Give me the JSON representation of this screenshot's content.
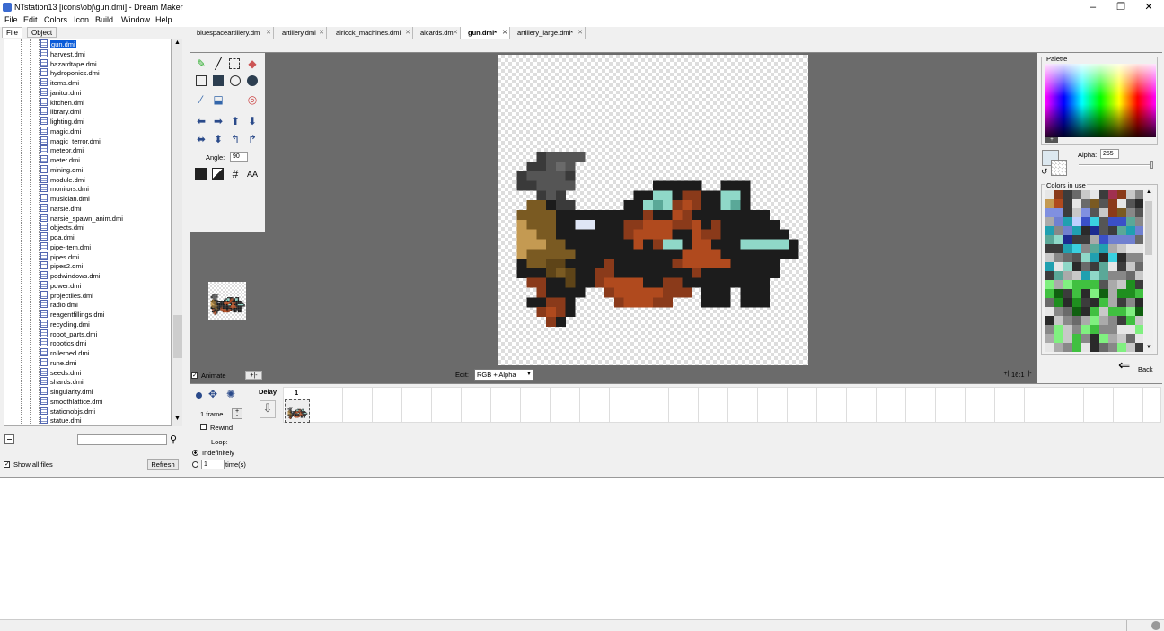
{
  "window": {
    "title": "NTstation13 [icons\\obj\\gun.dmi] - Dream Maker",
    "minimize": "–",
    "maximize": "❐",
    "close": "✕"
  },
  "menu": [
    "File",
    "Edit",
    "Colors",
    "Icon",
    "Build",
    "Window",
    "Help"
  ],
  "tree": {
    "tabs": [
      "File",
      "Object"
    ],
    "files": [
      "gun.dmi",
      "harvest.dmi",
      "hazardtape.dmi",
      "hydroponics.dmi",
      "items.dmi",
      "janitor.dmi",
      "kitchen.dmi",
      "library.dmi",
      "lighting.dmi",
      "magic.dmi",
      "magic_terror.dmi",
      "meteor.dmi",
      "meter.dmi",
      "mining.dmi",
      "module.dmi",
      "monitors.dmi",
      "musician.dmi",
      "narsie.dmi",
      "narsie_spawn_anim.dmi",
      "objects.dmi",
      "pda.dmi",
      "pipe-item.dmi",
      "pipes.dmi",
      "pipes2.dmi",
      "podwindows.dmi",
      "power.dmi",
      "projectiles.dmi",
      "radio.dmi",
      "reagentfillings.dmi",
      "recycling.dmi",
      "robot_parts.dmi",
      "robotics.dmi",
      "rollerbed.dmi",
      "rune.dmi",
      "seeds.dmi",
      "shards.dmi",
      "singularity.dmi",
      "smoothlattice.dmi",
      "stationobjs.dmi",
      "statue.dmi"
    ],
    "search_value": "",
    "show_all_label": "Show all files",
    "refresh_label": "Refresh"
  },
  "editor_tabs": [
    "bluespaceartillery.dm",
    "artillery.dmi",
    "airlock_machines.dmi",
    "aicards.dmi",
    "gun.dmi*",
    "artillery_large.dmi*"
  ],
  "tools": {
    "angle_label": "Angle:",
    "angle_value": "90",
    "aa_label": "AA"
  },
  "animate_label": "Animate",
  "edit_label": "Edit:",
  "edit_mode": "RGB + Alpha",
  "zoom": "16:1",
  "palette": {
    "label": "Palette",
    "alpha_label": "Alpha:",
    "alpha_value": "255",
    "colors_in_use_label": "Colors in use",
    "back_label": "Back"
  },
  "frames": {
    "delay_label": "Delay",
    "frame_number": "1",
    "frame_count": "1 frame",
    "rewind_label": "Rewind",
    "loop_label": "Loop:",
    "indefinitely_label": "Indefinitely",
    "times_value": "1",
    "times_label": "time(s)"
  }
}
